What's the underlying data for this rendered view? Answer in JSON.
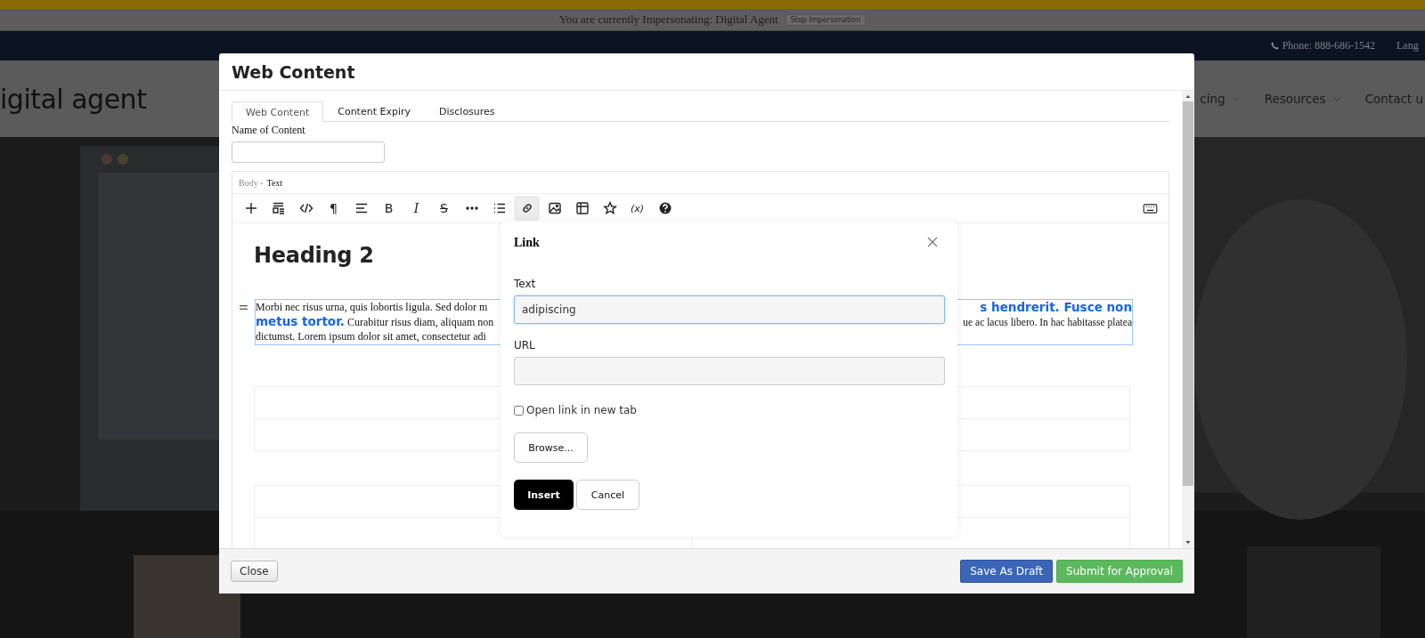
{
  "impersonation_bar": {
    "message": "You are currently Impersonating: Digital Agent",
    "button": "Stop Impersonation"
  },
  "top_bar": {
    "phone": "Phone: 888-686-1542",
    "language": "Lang"
  },
  "site_header": {
    "logo": "igital agent",
    "nav": [
      {
        "label": "cing",
        "has_menu": true
      },
      {
        "label": "Resources",
        "has_menu": true
      },
      {
        "label": "Contact u",
        "has_menu": false
      }
    ]
  },
  "modal": {
    "title": "Web Content",
    "tabs": [
      {
        "label": "Web Content",
        "selected": true
      },
      {
        "label": "Content Expiry",
        "selected": false
      },
      {
        "label": "Disclosures",
        "selected": false
      }
    ],
    "name_field": {
      "label": "Name of Content"
    },
    "editor": {
      "field_label": "Body -",
      "field_type": "Text",
      "toolbar": [
        {
          "kind": "icon",
          "selected": false
        },
        {
          "kind": "icon",
          "selected": false
        },
        {
          "kind": "icon",
          "selected": false
        },
        {
          "kind": "text",
          "label": "¶",
          "selected": false
        },
        {
          "kind": "icon",
          "selected": false
        },
        {
          "kind": "text",
          "label": "B",
          "selected": false
        },
        {
          "kind": "text",
          "label": "I",
          "selected": false
        },
        {
          "kind": "text",
          "label": "S",
          "selected": false
        },
        {
          "kind": "icon",
          "selected": false
        },
        {
          "kind": "icon",
          "selected": false
        },
        {
          "kind": "icon",
          "selected": true
        },
        {
          "kind": "icon",
          "selected": false
        },
        {
          "kind": "icon",
          "selected": false
        },
        {
          "kind": "icon",
          "selected": false
        },
        {
          "kind": "text",
          "label": "(x)",
          "selected": false
        },
        {
          "kind": "icon",
          "selected": false
        }
      ],
      "heading": "Heading 2",
      "paragraph_left": [
        "Morbi nec risus urna, quis lobortis ligula. Sed dolor m",
        "**metus tortor.** Curabitur risus diam, aliquam non",
        "dictumst. Lorem ipsum dolor sit amet, consectetur adi"
      ],
      "paragraph_right": [
        "**s hendrerit. Fusce non**",
        "ue ac lacus libero. In hac habitasse platea"
      ]
    },
    "link_dialog": {
      "title": "Link",
      "text_label": "Text",
      "text_value": "adipiscing",
      "url_label": "URL",
      "new_tab": {
        "label": "Open link in new tab",
        "checked": false
      },
      "browse": "Browse...",
      "insert": "Insert",
      "cancel": "Cancel"
    },
    "footer": {
      "close": "Close",
      "save_draft": "Save As Draft",
      "submit": "Submit for Approval"
    }
  }
}
